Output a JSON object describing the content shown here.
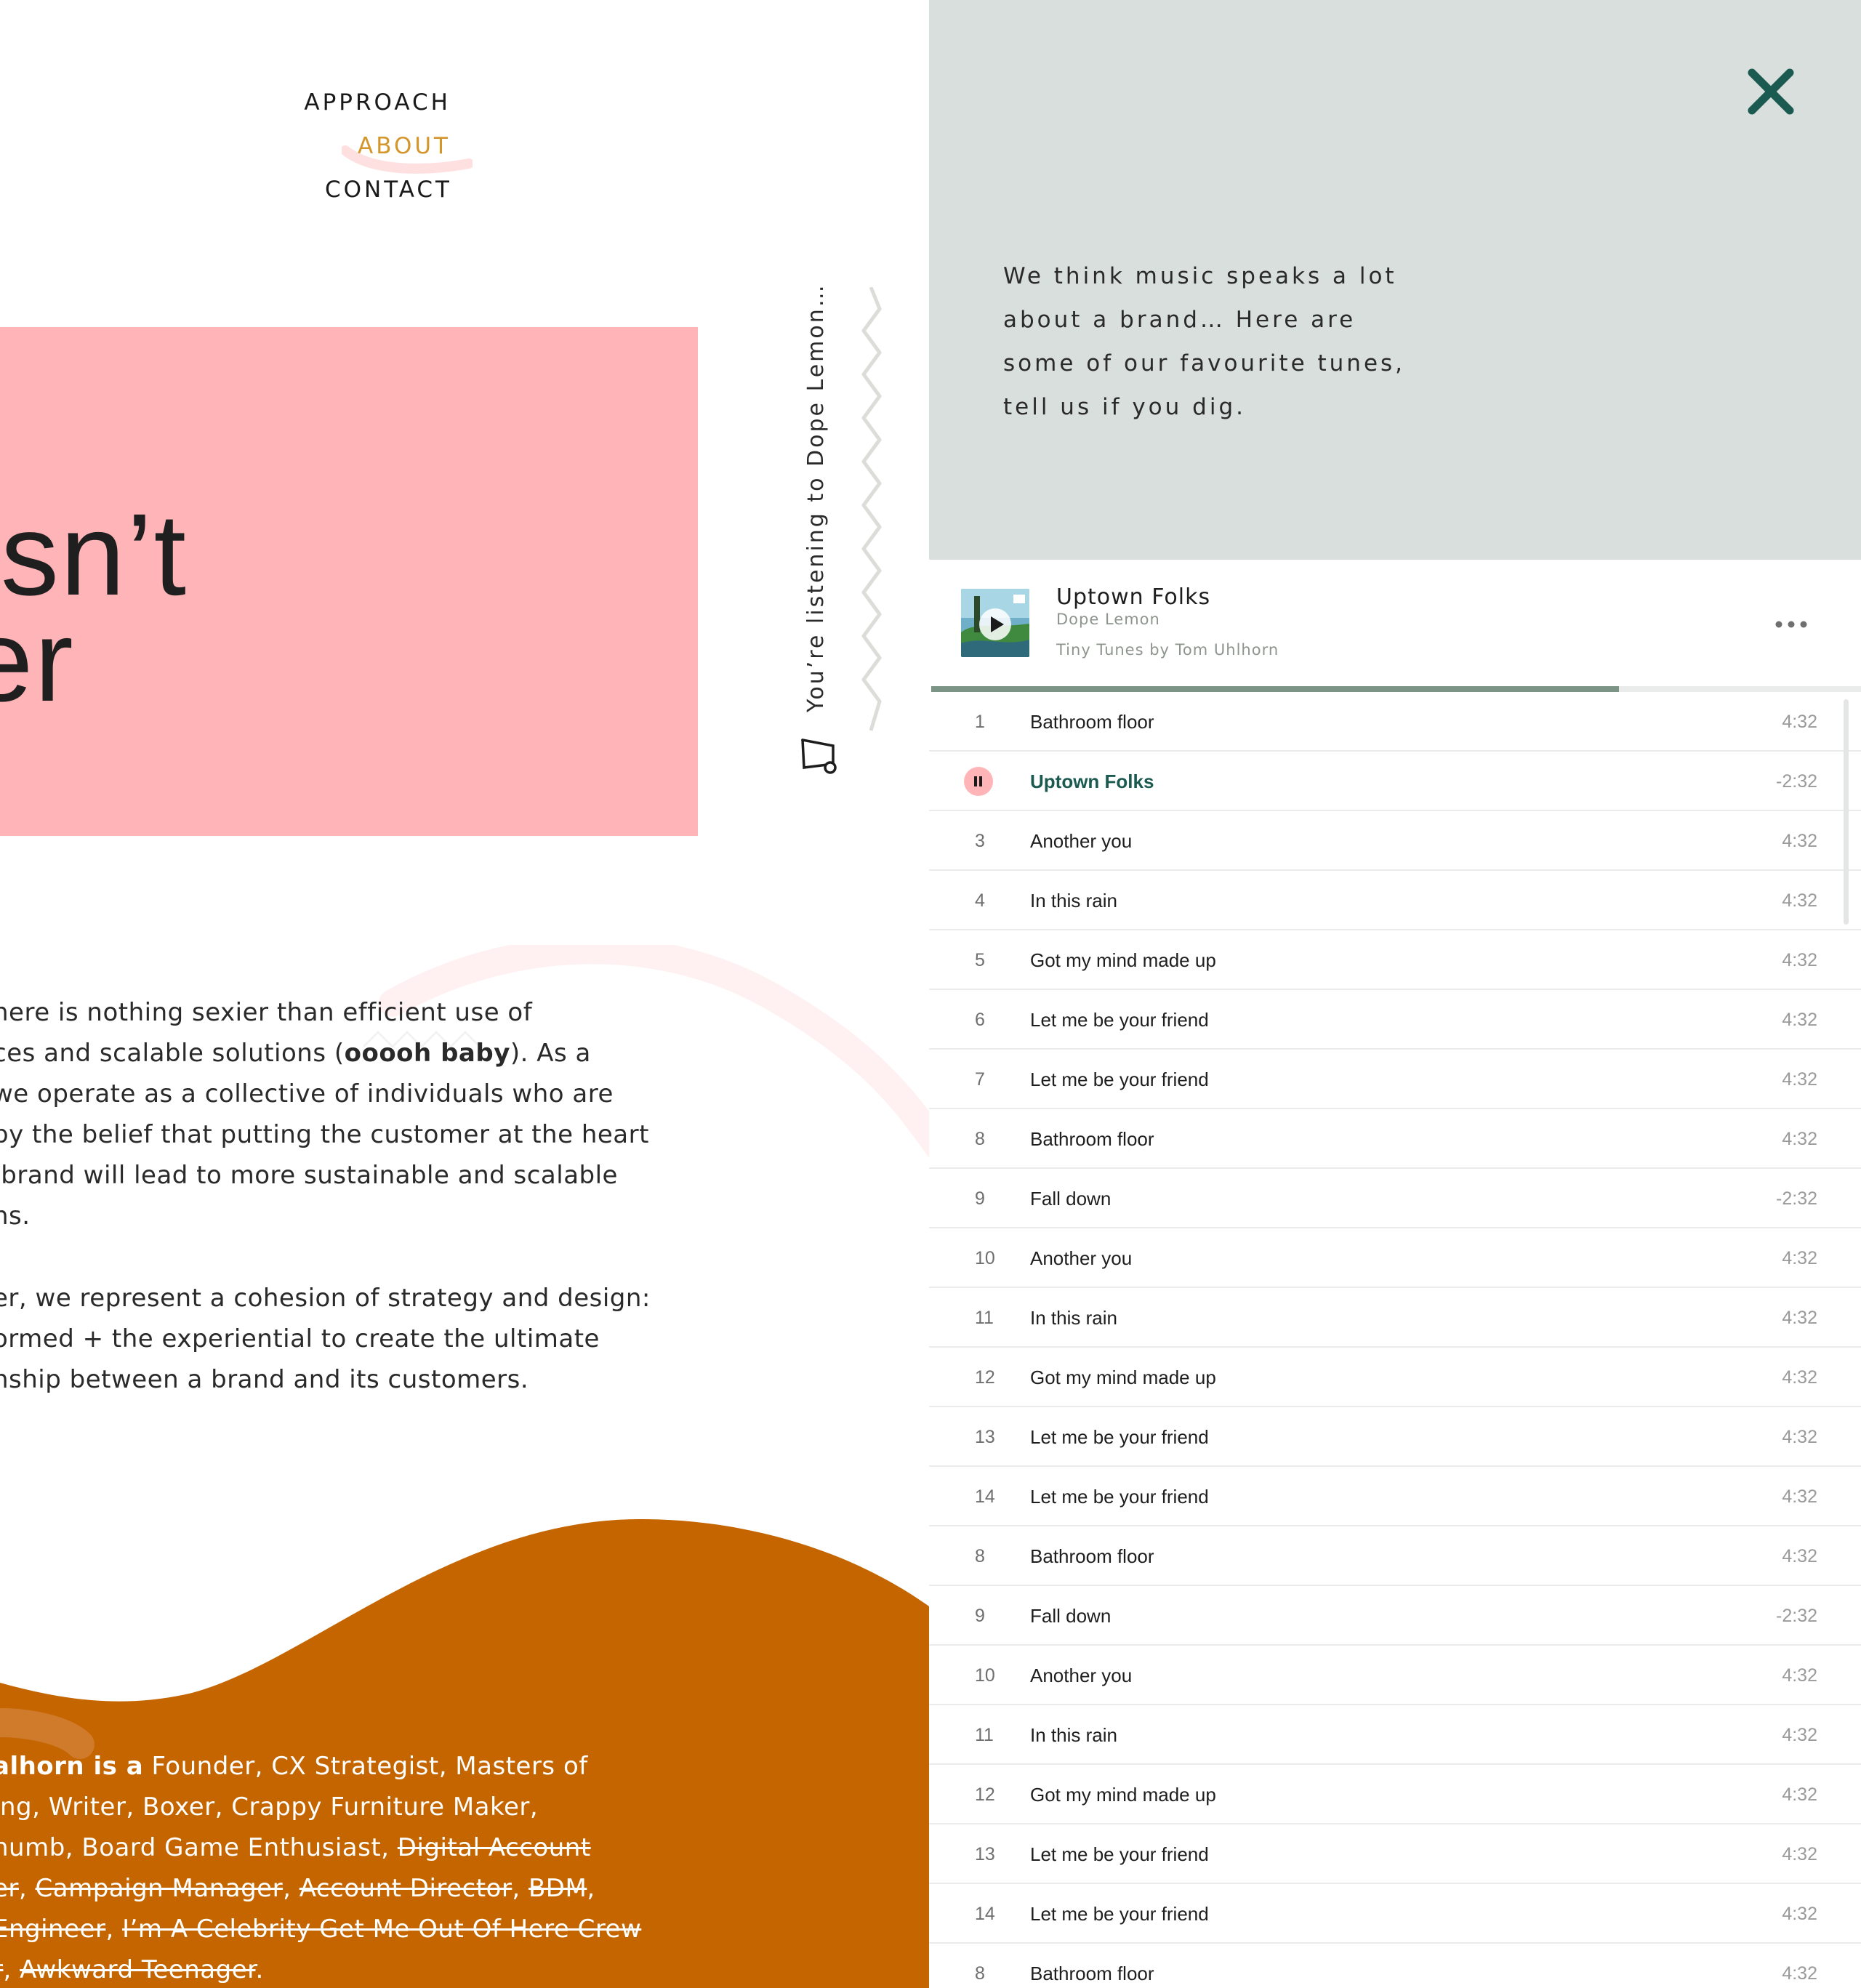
{
  "nav": {
    "approach": "APPROACH",
    "about": "ABOUT",
    "contact": "CONTACT"
  },
  "hero": {
    "lines": "esn’t\nter"
  },
  "copy": {
    "p1": [
      "here is nothing sexier than efficient use of",
      "ces and scalable solutions (",
      "ooooh baby",
      "). As a",
      "we operate as a collective of individuals who are",
      "by the belief that putting the customer at the heart",
      " brand will lead to more sustainable and scalable",
      "ns."
    ],
    "p2": [
      "er, we represent a cohesion of strategy and design:",
      "ormed + the experiential to create the ultimate",
      "nship between a brand and its customers."
    ]
  },
  "bio": {
    "lead": "alhorn is a",
    "l1": " Founder, CX Strategist, Masters of",
    "l2": "ing, Writer, Boxer, Crappy Furniture Maker,",
    "l3a": "humb, Board Game Enthusiast, ",
    "l3s": "Digital Account",
    "l4s1": "er",
    "l4s2": "Campaign Manager",
    "l4s3": "Account Director",
    "l4s4": "BDM",
    "l5s1": "Engineer",
    "l5s2": "I’m A Celebrity Get Me Out Of Here Crew",
    "l6s1": "r",
    "l6s2": "Awkward Teenager"
  },
  "listening": "You’re listening to Dope Lemon…",
  "colors": {
    "pink": "#ffb4b7",
    "orange": "#c46500",
    "about_accent": "#d4952a",
    "panel_bg": "#d9dfdd",
    "close_icon": "#1b5a50",
    "progress": "#7c9485"
  },
  "panel": {
    "intro": [
      "We think music speaks a lot",
      "about a brand… Here are",
      "some of our favourite tunes,",
      "tell us if you dig."
    ],
    "now_playing": {
      "title": "Uptown Folks",
      "artist": "Dope Lemon",
      "playlist": "Tiny Tunes by Tom Uhlhorn",
      "progress": 0.74
    },
    "tracks": [
      {
        "num": "1",
        "title": "Bathroom floor",
        "dur": "4:32"
      },
      {
        "num": "",
        "title": "Uptown Folks",
        "dur": "-2:32",
        "active": true
      },
      {
        "num": "3",
        "title": "Another you",
        "dur": "4:32"
      },
      {
        "num": "4",
        "title": "In this rain",
        "dur": "4:32"
      },
      {
        "num": "5",
        "title": "Got my mind made up",
        "dur": "4:32"
      },
      {
        "num": "6",
        "title": "Let me be your friend",
        "dur": "4:32"
      },
      {
        "num": "7",
        "title": "Let me be your friend",
        "dur": "4:32"
      },
      {
        "num": "8",
        "title": "Bathroom floor",
        "dur": "4:32"
      },
      {
        "num": "9",
        "title": "Fall down",
        "dur": "-2:32"
      },
      {
        "num": "10",
        "title": "Another you",
        "dur": "4:32"
      },
      {
        "num": "11",
        "title": "In this rain",
        "dur": "4:32"
      },
      {
        "num": "12",
        "title": "Got my mind made up",
        "dur": "4:32"
      },
      {
        "num": "13",
        "title": "Let me be your friend",
        "dur": "4:32"
      },
      {
        "num": "14",
        "title": "Let me be your friend",
        "dur": "4:32"
      },
      {
        "num": "8",
        "title": "Bathroom floor",
        "dur": "4:32"
      },
      {
        "num": "9",
        "title": "Fall down",
        "dur": "-2:32"
      },
      {
        "num": "10",
        "title": "Another you",
        "dur": "4:32"
      },
      {
        "num": "11",
        "title": "In this rain",
        "dur": "4:32"
      },
      {
        "num": "12",
        "title": "Got my mind made up",
        "dur": "4:32"
      },
      {
        "num": "13",
        "title": "Let me be your friend",
        "dur": "4:32"
      },
      {
        "num": "14",
        "title": "Let me be your friend",
        "dur": "4:32"
      },
      {
        "num": "8",
        "title": "Bathroom floor",
        "dur": "4:32"
      }
    ]
  }
}
